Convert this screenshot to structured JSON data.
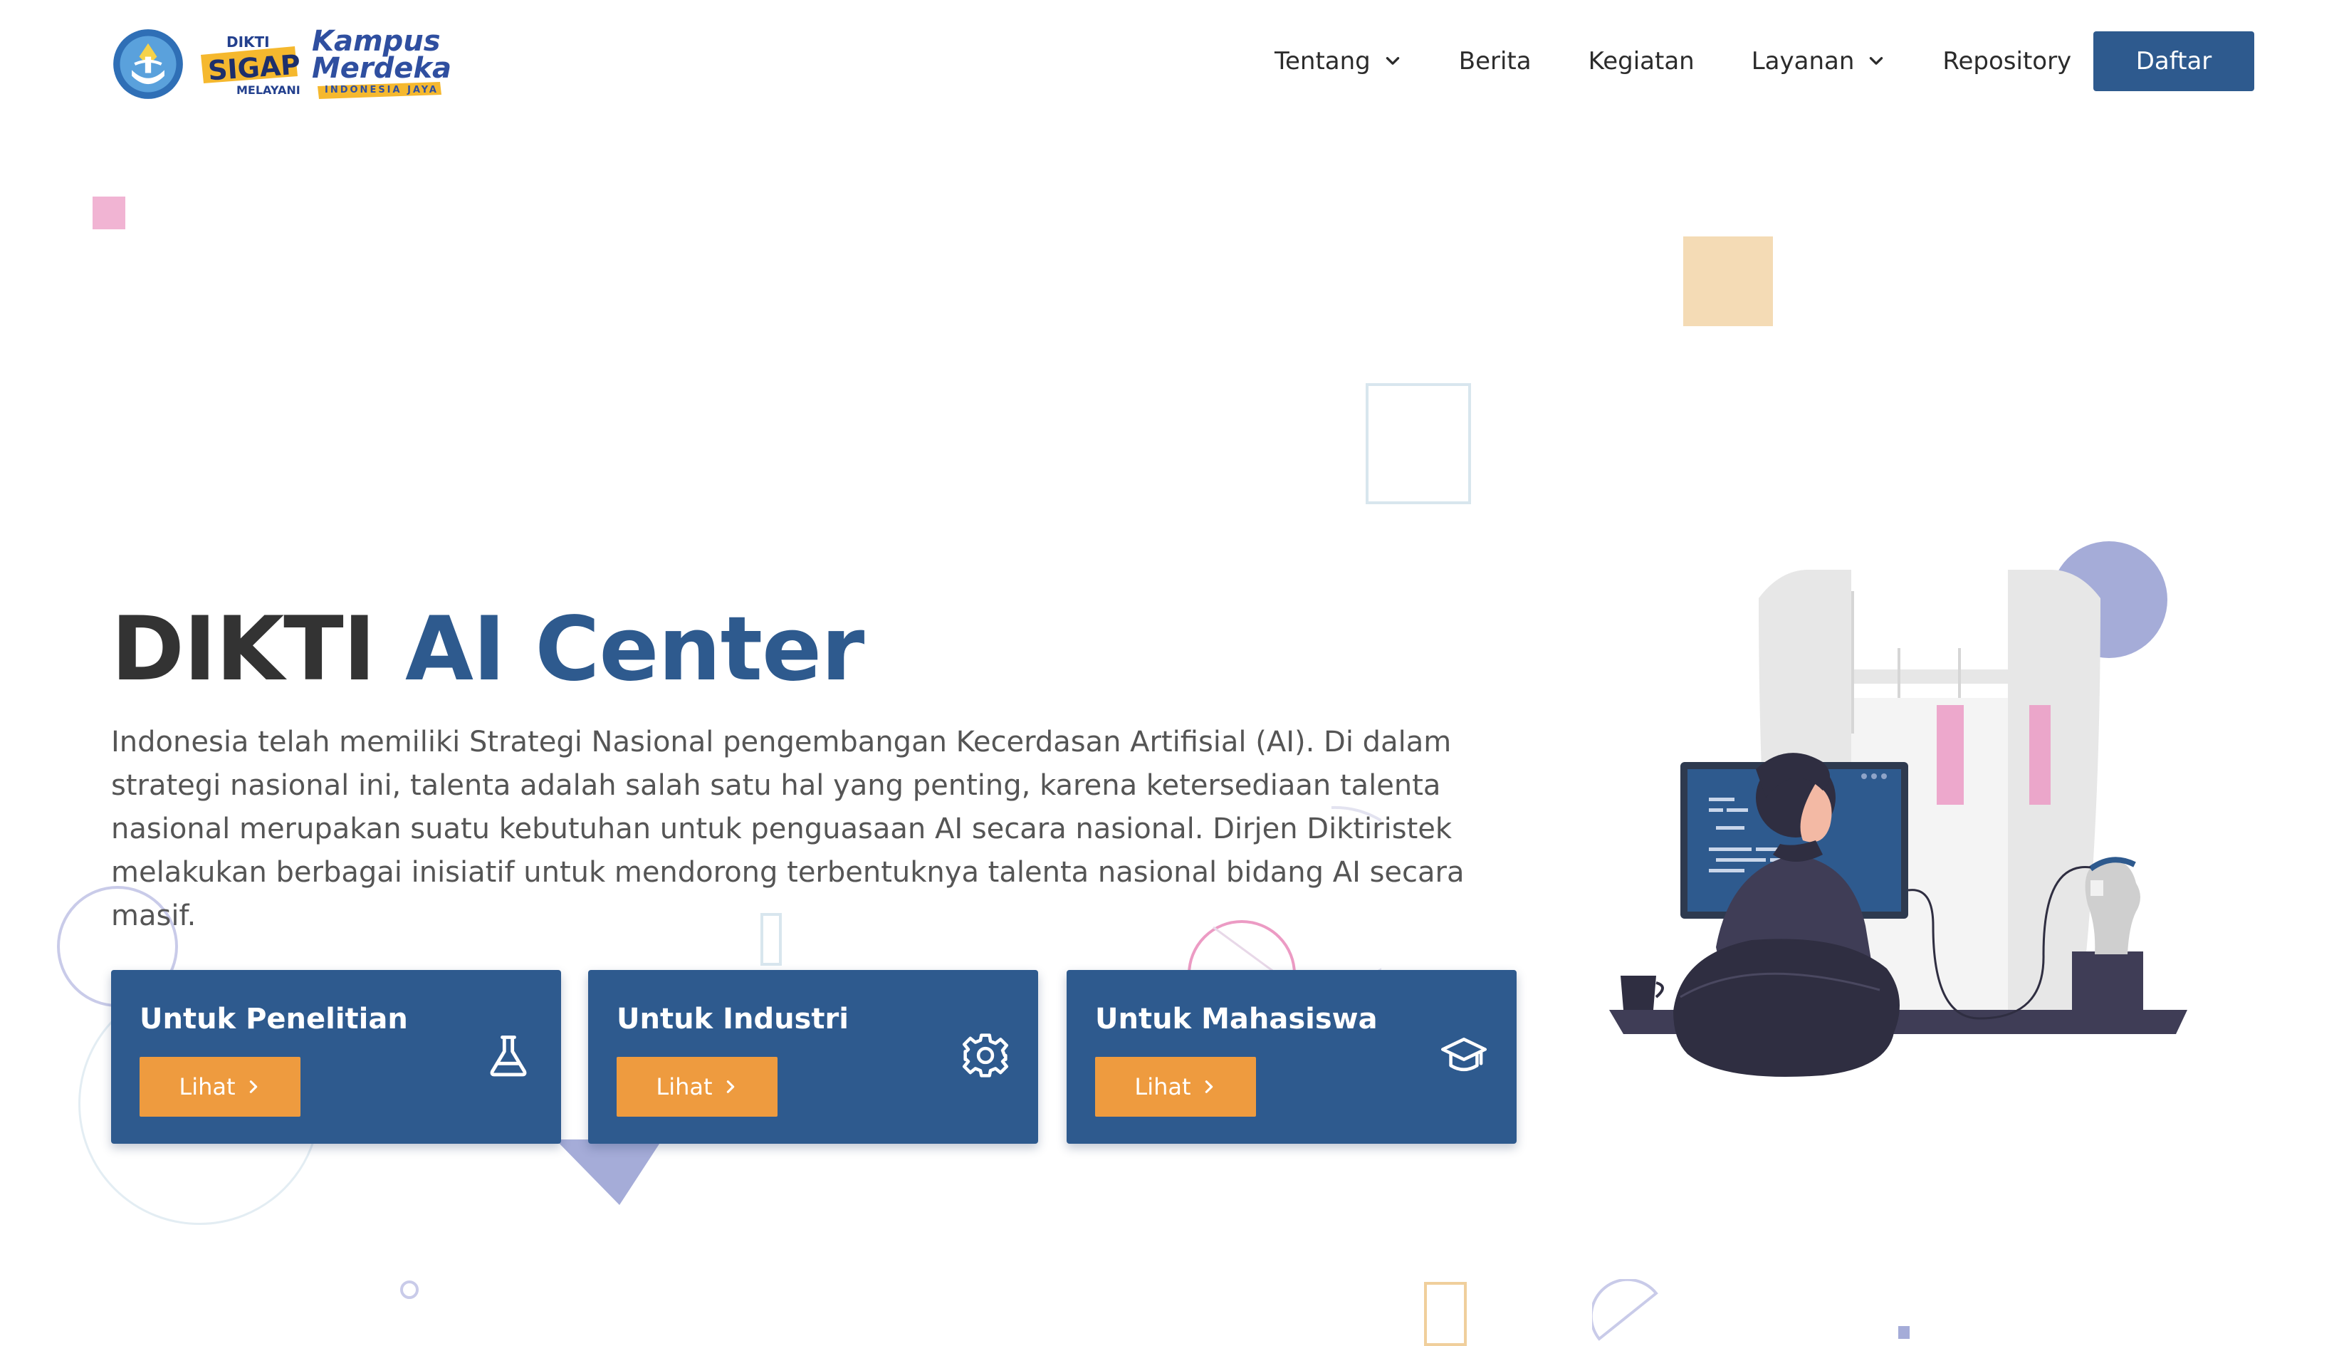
{
  "header": {
    "logos": {
      "sigap_top": "DIKTI",
      "sigap_main": "SIGAP",
      "sigap_bottom": "MELAYANI",
      "kampus_line1": "Kampus",
      "kampus_line2": "Merdeka",
      "kampus_tagline": "INDONESIA JAYA"
    },
    "nav": [
      {
        "label": "Tentang",
        "icon": "chevron-down-icon"
      },
      {
        "label": "Berita"
      },
      {
        "label": "Kegiatan"
      },
      {
        "label": "Layanan",
        "icon": "chevron-down-icon"
      },
      {
        "label": "Repository"
      }
    ],
    "cta_label": "Daftar"
  },
  "hero": {
    "title_part1": "DIKTI ",
    "title_part2": "AI Center",
    "description": "Indonesia telah memiliki Strategi Nasional pengembangan Kecerdasan Artifisial (AI). Di dalam strategi nasional ini, talenta adalah salah satu hal yang penting, karena ketersediaan talenta nasional merupakan suatu kebutuhan untuk penguasaan AI secara nasional. Dirjen Diktiristek melakukan berbagai inisiatif untuk mendorong terbentuknya talenta nasional bidang AI secara masif."
  },
  "cards": [
    {
      "title": "Untuk Penelitian",
      "button": "Lihat",
      "icon": "flask-icon"
    },
    {
      "title": "Untuk Industri",
      "button": "Lihat",
      "icon": "gear-icon"
    },
    {
      "title": "Untuk Mahasiswa",
      "button": "Lihat",
      "icon": "graduation-cap-icon"
    }
  ],
  "colors": {
    "primary": "#2e5a8e",
    "accent": "#ee9b3f",
    "text_dark": "#333333",
    "text_body": "#555555"
  }
}
